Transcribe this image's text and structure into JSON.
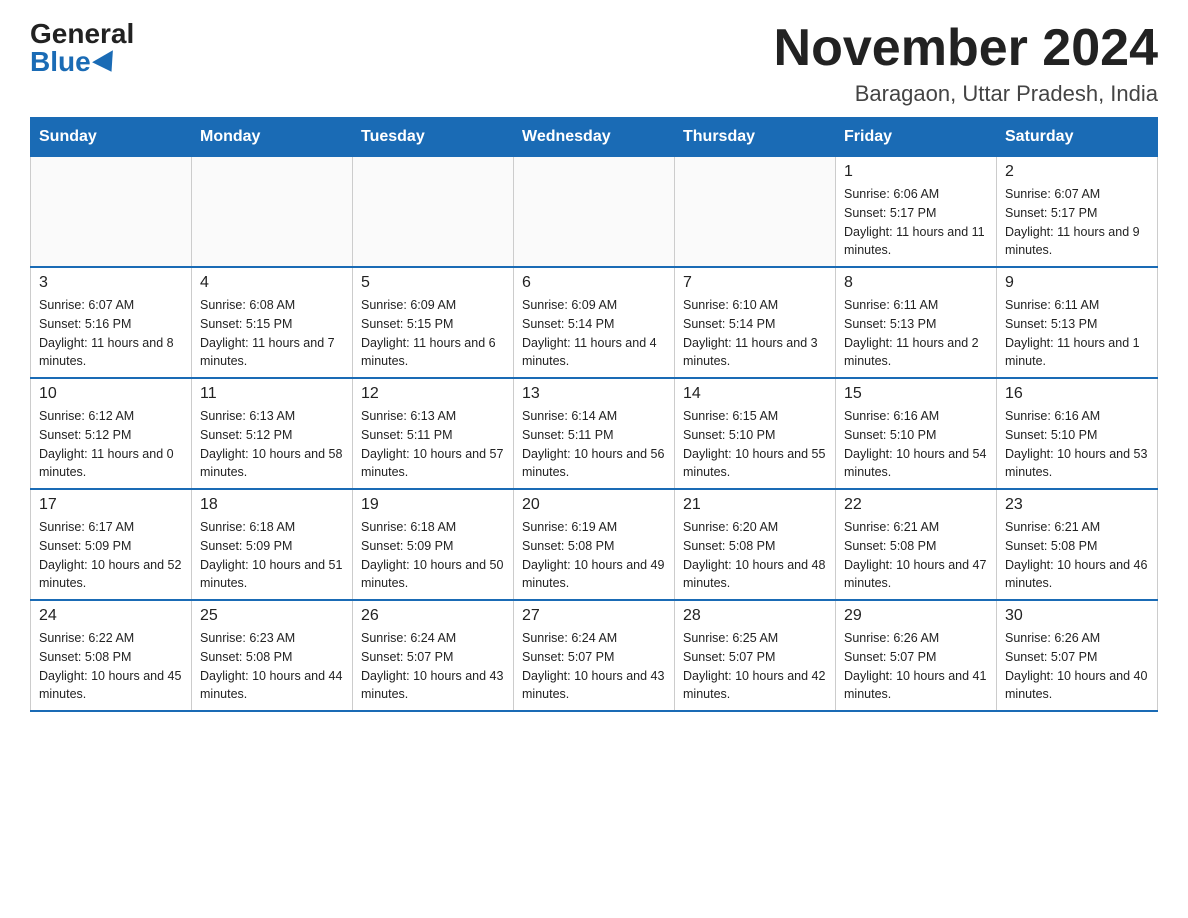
{
  "logo": {
    "general": "General",
    "blue": "Blue"
  },
  "title": "November 2024",
  "subtitle": "Baragaon, Uttar Pradesh, India",
  "weekdays": [
    "Sunday",
    "Monday",
    "Tuesday",
    "Wednesday",
    "Thursday",
    "Friday",
    "Saturday"
  ],
  "weeks": [
    [
      {
        "day": "",
        "info": ""
      },
      {
        "day": "",
        "info": ""
      },
      {
        "day": "",
        "info": ""
      },
      {
        "day": "",
        "info": ""
      },
      {
        "day": "",
        "info": ""
      },
      {
        "day": "1",
        "info": "Sunrise: 6:06 AM\nSunset: 5:17 PM\nDaylight: 11 hours and 11 minutes."
      },
      {
        "day": "2",
        "info": "Sunrise: 6:07 AM\nSunset: 5:17 PM\nDaylight: 11 hours and 9 minutes."
      }
    ],
    [
      {
        "day": "3",
        "info": "Sunrise: 6:07 AM\nSunset: 5:16 PM\nDaylight: 11 hours and 8 minutes."
      },
      {
        "day": "4",
        "info": "Sunrise: 6:08 AM\nSunset: 5:15 PM\nDaylight: 11 hours and 7 minutes."
      },
      {
        "day": "5",
        "info": "Sunrise: 6:09 AM\nSunset: 5:15 PM\nDaylight: 11 hours and 6 minutes."
      },
      {
        "day": "6",
        "info": "Sunrise: 6:09 AM\nSunset: 5:14 PM\nDaylight: 11 hours and 4 minutes."
      },
      {
        "day": "7",
        "info": "Sunrise: 6:10 AM\nSunset: 5:14 PM\nDaylight: 11 hours and 3 minutes."
      },
      {
        "day": "8",
        "info": "Sunrise: 6:11 AM\nSunset: 5:13 PM\nDaylight: 11 hours and 2 minutes."
      },
      {
        "day": "9",
        "info": "Sunrise: 6:11 AM\nSunset: 5:13 PM\nDaylight: 11 hours and 1 minute."
      }
    ],
    [
      {
        "day": "10",
        "info": "Sunrise: 6:12 AM\nSunset: 5:12 PM\nDaylight: 11 hours and 0 minutes."
      },
      {
        "day": "11",
        "info": "Sunrise: 6:13 AM\nSunset: 5:12 PM\nDaylight: 10 hours and 58 minutes."
      },
      {
        "day": "12",
        "info": "Sunrise: 6:13 AM\nSunset: 5:11 PM\nDaylight: 10 hours and 57 minutes."
      },
      {
        "day": "13",
        "info": "Sunrise: 6:14 AM\nSunset: 5:11 PM\nDaylight: 10 hours and 56 minutes."
      },
      {
        "day": "14",
        "info": "Sunrise: 6:15 AM\nSunset: 5:10 PM\nDaylight: 10 hours and 55 minutes."
      },
      {
        "day": "15",
        "info": "Sunrise: 6:16 AM\nSunset: 5:10 PM\nDaylight: 10 hours and 54 minutes."
      },
      {
        "day": "16",
        "info": "Sunrise: 6:16 AM\nSunset: 5:10 PM\nDaylight: 10 hours and 53 minutes."
      }
    ],
    [
      {
        "day": "17",
        "info": "Sunrise: 6:17 AM\nSunset: 5:09 PM\nDaylight: 10 hours and 52 minutes."
      },
      {
        "day": "18",
        "info": "Sunrise: 6:18 AM\nSunset: 5:09 PM\nDaylight: 10 hours and 51 minutes."
      },
      {
        "day": "19",
        "info": "Sunrise: 6:18 AM\nSunset: 5:09 PM\nDaylight: 10 hours and 50 minutes."
      },
      {
        "day": "20",
        "info": "Sunrise: 6:19 AM\nSunset: 5:08 PM\nDaylight: 10 hours and 49 minutes."
      },
      {
        "day": "21",
        "info": "Sunrise: 6:20 AM\nSunset: 5:08 PM\nDaylight: 10 hours and 48 minutes."
      },
      {
        "day": "22",
        "info": "Sunrise: 6:21 AM\nSunset: 5:08 PM\nDaylight: 10 hours and 47 minutes."
      },
      {
        "day": "23",
        "info": "Sunrise: 6:21 AM\nSunset: 5:08 PM\nDaylight: 10 hours and 46 minutes."
      }
    ],
    [
      {
        "day": "24",
        "info": "Sunrise: 6:22 AM\nSunset: 5:08 PM\nDaylight: 10 hours and 45 minutes."
      },
      {
        "day": "25",
        "info": "Sunrise: 6:23 AM\nSunset: 5:08 PM\nDaylight: 10 hours and 44 minutes."
      },
      {
        "day": "26",
        "info": "Sunrise: 6:24 AM\nSunset: 5:07 PM\nDaylight: 10 hours and 43 minutes."
      },
      {
        "day": "27",
        "info": "Sunrise: 6:24 AM\nSunset: 5:07 PM\nDaylight: 10 hours and 43 minutes."
      },
      {
        "day": "28",
        "info": "Sunrise: 6:25 AM\nSunset: 5:07 PM\nDaylight: 10 hours and 42 minutes."
      },
      {
        "day": "29",
        "info": "Sunrise: 6:26 AM\nSunset: 5:07 PM\nDaylight: 10 hours and 41 minutes."
      },
      {
        "day": "30",
        "info": "Sunrise: 6:26 AM\nSunset: 5:07 PM\nDaylight: 10 hours and 40 minutes."
      }
    ]
  ]
}
